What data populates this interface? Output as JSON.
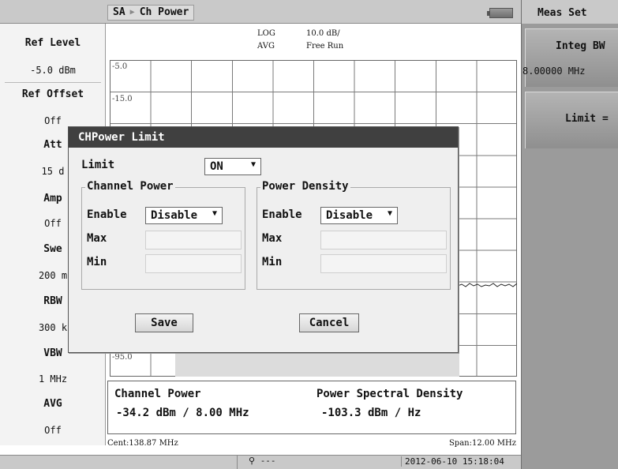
{
  "header": {
    "mode": "SA",
    "measurement": "Ch Power",
    "scale": "LOG",
    "scale_per_div": "10.0 dB/",
    "detector": "AVG",
    "sweep_mode": "Free Run"
  },
  "left_panel": {
    "ref_level": {
      "label": "Ref Level",
      "value": "-5.0 dBm"
    },
    "ref_offset": {
      "label": "Ref Offset",
      "value": "Off"
    },
    "att": {
      "label": "Att",
      "value": "15 d"
    },
    "amp": {
      "label": "Amp",
      "value": "Off"
    },
    "sweep": {
      "label": "Swe",
      "value": "200 m"
    },
    "rbw": {
      "label": "RBW",
      "value": "300 k"
    },
    "vbw": {
      "label": "VBW",
      "value": "1 MHz"
    },
    "avg": {
      "label": "AVG",
      "value": "Off"
    }
  },
  "graph": {
    "y_labels": [
      "-5.0",
      "-15.0",
      "-95.0"
    ]
  },
  "results": {
    "channel_power_label": "Channel Power",
    "channel_power_value": "-34.2 dBm / 8.00 MHz",
    "psd_label": "Power Spectral Density",
    "psd_value": "-103.3 dBm / Hz"
  },
  "footer": {
    "center": "Cent:138.87 MHz",
    "span": "Span:12.00 MHz"
  },
  "statusbar": {
    "gps": "---",
    "datetime": "2012-06-10 15:18:04"
  },
  "right_panel": {
    "title": "Meas Set",
    "integ_bw_label": "Integ BW",
    "integ_bw_value": "8.00000 MHz",
    "limit_label": "Limit ="
  },
  "dialog": {
    "title": "CHPower Limit",
    "limit_label": "Limit",
    "limit_value": "ON",
    "channel_power": {
      "title": "Channel Power",
      "enable_label": "Enable",
      "enable_value": "Disable",
      "max_label": "Max",
      "min_label": "Min"
    },
    "power_density": {
      "title": "Power Density",
      "enable_label": "Enable",
      "enable_value": "Disable",
      "max_label": "Max",
      "min_label": "Min"
    },
    "save_label": "Save",
    "cancel_label": "Cancel"
  }
}
